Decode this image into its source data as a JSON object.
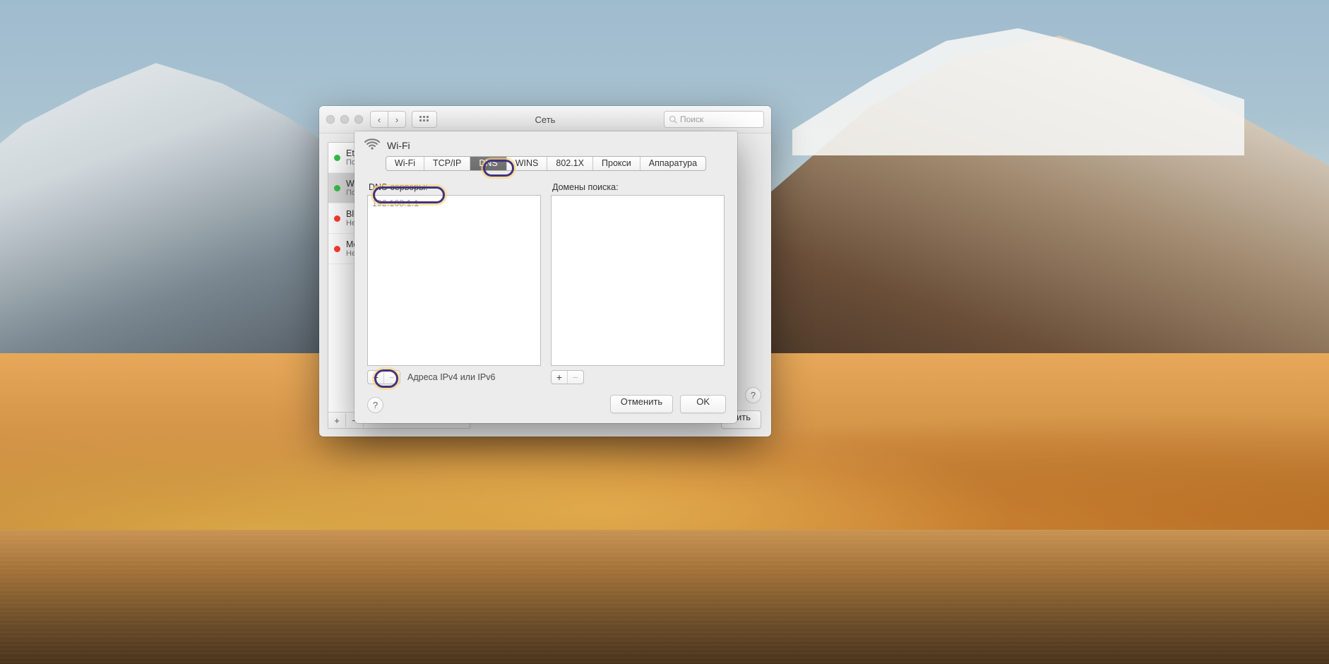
{
  "window": {
    "title": "Сеть",
    "search_placeholder": "Поиск",
    "services": [
      {
        "name": "Eth",
        "status": "Под",
        "state": "green"
      },
      {
        "name": "Wi-",
        "status": "Под",
        "state": "green"
      },
      {
        "name": "Blu",
        "status": "Не",
        "state": "red"
      },
      {
        "name": "Mo",
        "status": "Не",
        "state": "red"
      }
    ],
    "selected_index": 1,
    "apply_label": "нить"
  },
  "sheet": {
    "header_title": "Wi-Fi",
    "tabs": [
      "Wi-Fi",
      "TCP/IP",
      "DNS",
      "WINS",
      "802.1X",
      "Прокси",
      "Аппаратура"
    ],
    "active_tab": 2,
    "dns": {
      "servers_label": "DNS-серверы:",
      "servers": [
        "192.168.1.1"
      ],
      "search_label": "Домены поиска:",
      "hint": "Адреса IPv4 или IPv6"
    },
    "cancel_label": "Отменить",
    "ok_label": "OK"
  }
}
